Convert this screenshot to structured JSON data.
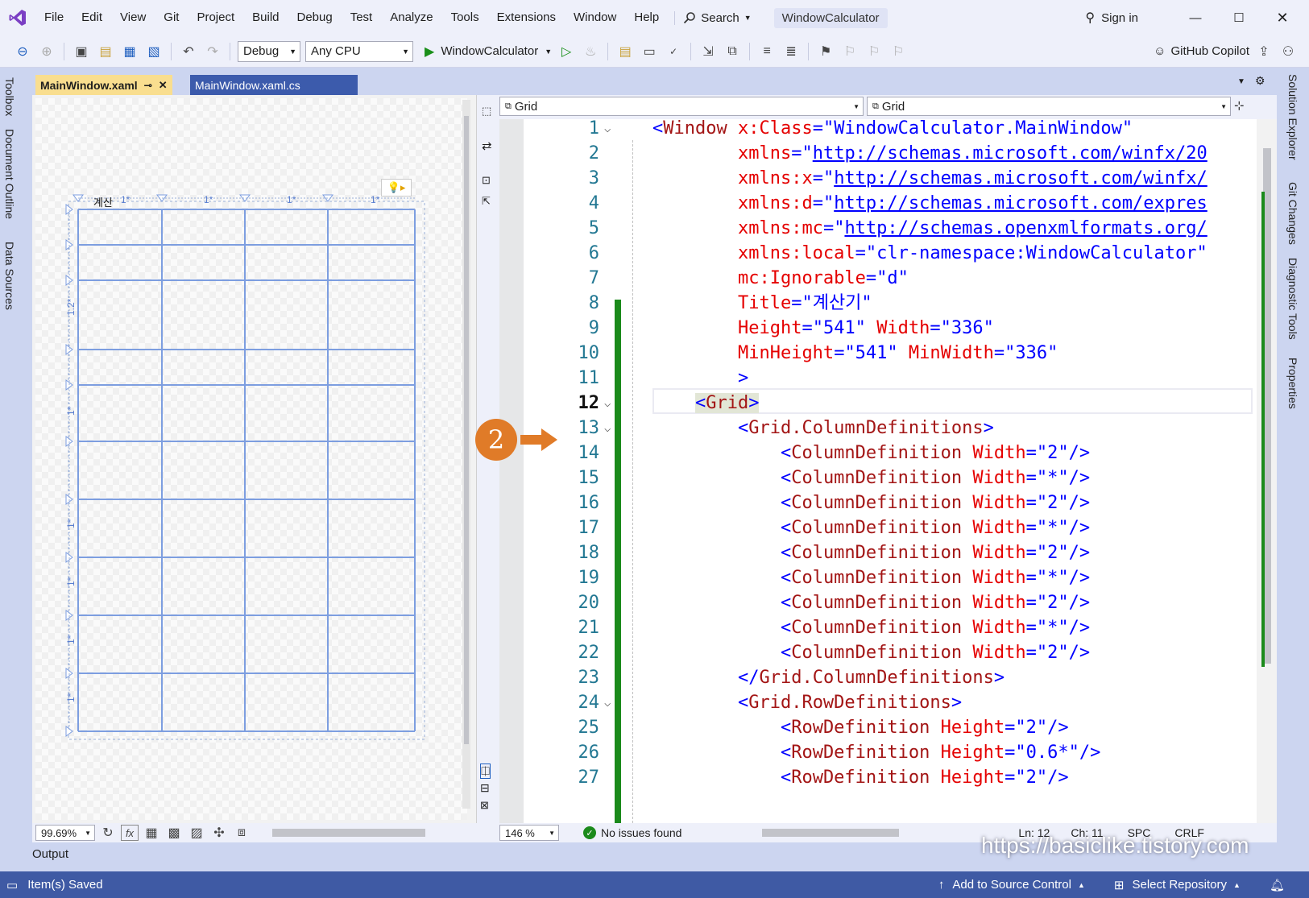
{
  "menubar": {
    "items": [
      "File",
      "Edit",
      "View",
      "Git",
      "Project",
      "Build",
      "Debug",
      "Test",
      "Analyze",
      "Tools",
      "Extensions",
      "Window",
      "Help"
    ],
    "search_label": "Search",
    "solution_title": "WindowCalculator",
    "sign_in": "Sign in"
  },
  "toolbar": {
    "config": "Debug",
    "platform": "Any CPU",
    "run_target": "WindowCalculator",
    "copilot": "GitHub Copilot"
  },
  "tabs": {
    "active": "MainWindow.xaml",
    "inactive": "MainWindow.xaml.cs"
  },
  "left_tool_tabs": [
    "Toolbox",
    "Document Outline",
    "Data Sources"
  ],
  "right_tool_tabs": [
    "Solution Explorer",
    "Git Changes",
    "Diagnostic Tools",
    "Properties"
  ],
  "designer": {
    "preview_title": "계산",
    "column_labels": [
      "1*",
      "1*",
      "1*",
      "1*"
    ],
    "row_labels": [
      "1.2*",
      "1*",
      "1*",
      "1*",
      "1*",
      "1*"
    ],
    "zoom": "99.69%",
    "fx_label": "fx"
  },
  "editor": {
    "nav_left": "Grid",
    "nav_right": "Grid",
    "zoom": "146 %",
    "issues": "No issues found",
    "ln": "Ln: 12",
    "ch": "Ch: 11",
    "spc": "SPC",
    "crlf": "CRLF",
    "lines": [
      {
        "n": "1",
        "parts": [
          [
            "punc",
            "<"
          ],
          [
            "tag",
            "Window"
          ],
          [
            "plain",
            " "
          ],
          [
            "attr",
            "x:Class"
          ],
          [
            "punc",
            "="
          ],
          [
            "val",
            "\"WindowCalculator.MainWindow\""
          ]
        ]
      },
      {
        "n": "2",
        "parts": [
          [
            "plain",
            "        "
          ],
          [
            "attr",
            "xmlns"
          ],
          [
            "punc",
            "="
          ],
          [
            "punc",
            "\""
          ],
          [
            "link",
            "http://schemas.microsoft.com/winfx/20"
          ]
        ]
      },
      {
        "n": "3",
        "parts": [
          [
            "plain",
            "        "
          ],
          [
            "attr",
            "xmlns:x"
          ],
          [
            "punc",
            "="
          ],
          [
            "punc",
            "\""
          ],
          [
            "link",
            "http://schemas.microsoft.com/winfx/"
          ]
        ]
      },
      {
        "n": "4",
        "parts": [
          [
            "plain",
            "        "
          ],
          [
            "attr",
            "xmlns:d"
          ],
          [
            "punc",
            "="
          ],
          [
            "punc",
            "\""
          ],
          [
            "link",
            "http://schemas.microsoft.com/expres"
          ]
        ]
      },
      {
        "n": "5",
        "parts": [
          [
            "plain",
            "        "
          ],
          [
            "attr",
            "xmlns:mc"
          ],
          [
            "punc",
            "="
          ],
          [
            "punc",
            "\""
          ],
          [
            "link",
            "http://schemas.openxmlformats.org/"
          ]
        ]
      },
      {
        "n": "6",
        "parts": [
          [
            "plain",
            "        "
          ],
          [
            "attr",
            "xmlns:local"
          ],
          [
            "punc",
            "="
          ],
          [
            "val",
            "\"clr-namespace:WindowCalculator\""
          ]
        ]
      },
      {
        "n": "7",
        "parts": [
          [
            "plain",
            "        "
          ],
          [
            "attr",
            "mc:Ignorable"
          ],
          [
            "punc",
            "="
          ],
          [
            "val",
            "\"d\""
          ]
        ]
      },
      {
        "n": "8",
        "parts": [
          [
            "plain",
            "        "
          ],
          [
            "attr",
            "Title"
          ],
          [
            "punc",
            "="
          ],
          [
            "val",
            "\"계산기\""
          ]
        ]
      },
      {
        "n": "9",
        "parts": [
          [
            "plain",
            "        "
          ],
          [
            "attr",
            "Height"
          ],
          [
            "punc",
            "="
          ],
          [
            "val",
            "\"541\""
          ],
          [
            "plain",
            " "
          ],
          [
            "attr",
            "Width"
          ],
          [
            "punc",
            "="
          ],
          [
            "val",
            "\"336\""
          ]
        ]
      },
      {
        "n": "10",
        "parts": [
          [
            "plain",
            "        "
          ],
          [
            "attr",
            "MinHeight"
          ],
          [
            "punc",
            "="
          ],
          [
            "val",
            "\"541\""
          ],
          [
            "plain",
            " "
          ],
          [
            "attr",
            "MinWidth"
          ],
          [
            "punc",
            "="
          ],
          [
            "val",
            "\"336\""
          ]
        ]
      },
      {
        "n": "11",
        "parts": [
          [
            "plain",
            "        "
          ],
          [
            "punc",
            ">"
          ]
        ]
      },
      {
        "n": "12",
        "parts": [
          [
            "plain",
            "    "
          ],
          [
            "punc",
            "<"
          ],
          [
            "tag",
            "Grid"
          ],
          [
            "punc",
            ">"
          ]
        ]
      },
      {
        "n": "13",
        "parts": [
          [
            "plain",
            "        "
          ],
          [
            "punc",
            "<"
          ],
          [
            "tag",
            "Grid.ColumnDefinitions"
          ],
          [
            "punc",
            ">"
          ]
        ]
      },
      {
        "n": "14",
        "parts": [
          [
            "plain",
            "            "
          ],
          [
            "punc",
            "<"
          ],
          [
            "tag",
            "ColumnDefinition"
          ],
          [
            "plain",
            " "
          ],
          [
            "attr",
            "Width"
          ],
          [
            "punc",
            "="
          ],
          [
            "val",
            "\"2\""
          ],
          [
            "punc",
            "/>"
          ]
        ]
      },
      {
        "n": "15",
        "parts": [
          [
            "plain",
            "            "
          ],
          [
            "punc",
            "<"
          ],
          [
            "tag",
            "ColumnDefinition"
          ],
          [
            "plain",
            " "
          ],
          [
            "attr",
            "Width"
          ],
          [
            "punc",
            "="
          ],
          [
            "val",
            "\"*\""
          ],
          [
            "punc",
            "/>"
          ]
        ]
      },
      {
        "n": "16",
        "parts": [
          [
            "plain",
            "            "
          ],
          [
            "punc",
            "<"
          ],
          [
            "tag",
            "ColumnDefinition"
          ],
          [
            "plain",
            " "
          ],
          [
            "attr",
            "Width"
          ],
          [
            "punc",
            "="
          ],
          [
            "val",
            "\"2\""
          ],
          [
            "punc",
            "/>"
          ]
        ]
      },
      {
        "n": "17",
        "parts": [
          [
            "plain",
            "            "
          ],
          [
            "punc",
            "<"
          ],
          [
            "tag",
            "ColumnDefinition"
          ],
          [
            "plain",
            " "
          ],
          [
            "attr",
            "Width"
          ],
          [
            "punc",
            "="
          ],
          [
            "val",
            "\"*\""
          ],
          [
            "punc",
            "/>"
          ]
        ]
      },
      {
        "n": "18",
        "parts": [
          [
            "plain",
            "            "
          ],
          [
            "punc",
            "<"
          ],
          [
            "tag",
            "ColumnDefinition"
          ],
          [
            "plain",
            " "
          ],
          [
            "attr",
            "Width"
          ],
          [
            "punc",
            "="
          ],
          [
            "val",
            "\"2\""
          ],
          [
            "punc",
            "/>"
          ]
        ]
      },
      {
        "n": "19",
        "parts": [
          [
            "plain",
            "            "
          ],
          [
            "punc",
            "<"
          ],
          [
            "tag",
            "ColumnDefinition"
          ],
          [
            "plain",
            " "
          ],
          [
            "attr",
            "Width"
          ],
          [
            "punc",
            "="
          ],
          [
            "val",
            "\"*\""
          ],
          [
            "punc",
            "/>"
          ]
        ]
      },
      {
        "n": "20",
        "parts": [
          [
            "plain",
            "            "
          ],
          [
            "punc",
            "<"
          ],
          [
            "tag",
            "ColumnDefinition"
          ],
          [
            "plain",
            " "
          ],
          [
            "attr",
            "Width"
          ],
          [
            "punc",
            "="
          ],
          [
            "val",
            "\"2\""
          ],
          [
            "punc",
            "/>"
          ]
        ]
      },
      {
        "n": "21",
        "parts": [
          [
            "plain",
            "            "
          ],
          [
            "punc",
            "<"
          ],
          [
            "tag",
            "ColumnDefinition"
          ],
          [
            "plain",
            " "
          ],
          [
            "attr",
            "Width"
          ],
          [
            "punc",
            "="
          ],
          [
            "val",
            "\"*\""
          ],
          [
            "punc",
            "/>"
          ]
        ]
      },
      {
        "n": "22",
        "parts": [
          [
            "plain",
            "            "
          ],
          [
            "punc",
            "<"
          ],
          [
            "tag",
            "ColumnDefinition"
          ],
          [
            "plain",
            " "
          ],
          [
            "attr",
            "Width"
          ],
          [
            "punc",
            "="
          ],
          [
            "val",
            "\"2\""
          ],
          [
            "punc",
            "/>"
          ]
        ]
      },
      {
        "n": "23",
        "parts": [
          [
            "plain",
            "        "
          ],
          [
            "punc",
            "</"
          ],
          [
            "tag",
            "Grid.ColumnDefinitions"
          ],
          [
            "punc",
            ">"
          ]
        ]
      },
      {
        "n": "24",
        "parts": [
          [
            "plain",
            "        "
          ],
          [
            "punc",
            "<"
          ],
          [
            "tag",
            "Grid.RowDefinitions"
          ],
          [
            "punc",
            ">"
          ]
        ]
      },
      {
        "n": "25",
        "parts": [
          [
            "plain",
            "            "
          ],
          [
            "punc",
            "<"
          ],
          [
            "tag",
            "RowDefinition"
          ],
          [
            "plain",
            " "
          ],
          [
            "attr",
            "Height"
          ],
          [
            "punc",
            "="
          ],
          [
            "val",
            "\"2\""
          ],
          [
            "punc",
            "/>"
          ]
        ]
      },
      {
        "n": "26",
        "parts": [
          [
            "plain",
            "            "
          ],
          [
            "punc",
            "<"
          ],
          [
            "tag",
            "RowDefinition"
          ],
          [
            "plain",
            " "
          ],
          [
            "attr",
            "Height"
          ],
          [
            "punc",
            "="
          ],
          [
            "val",
            "\"0.6*\""
          ],
          [
            "punc",
            "/>"
          ]
        ]
      },
      {
        "n": "27",
        "parts": [
          [
            "plain",
            "            "
          ],
          [
            "punc",
            "<"
          ],
          [
            "tag",
            "RowDefinition"
          ],
          [
            "plain",
            " "
          ],
          [
            "attr",
            "Height"
          ],
          [
            "punc",
            "="
          ],
          [
            "val",
            "\"2\""
          ],
          [
            "punc",
            "/>"
          ]
        ]
      }
    ]
  },
  "annotation": {
    "badge": "2"
  },
  "output_label": "Output",
  "watermark": "https://basiclike.tistory.com",
  "statusbar": {
    "saved": "Item(s) Saved",
    "source_control": "Add to Source Control",
    "repository": "Select Repository"
  }
}
